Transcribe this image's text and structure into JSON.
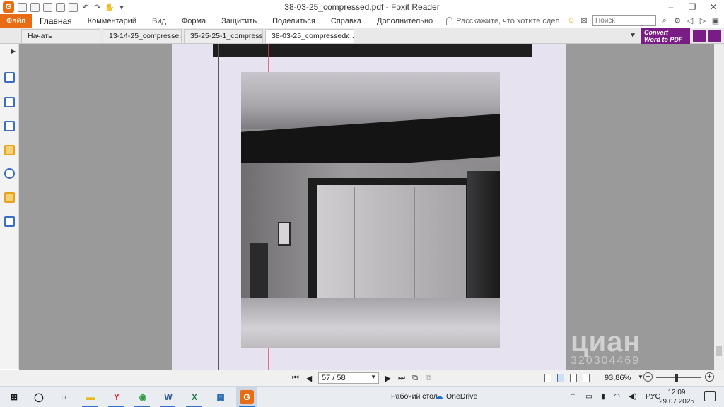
{
  "window": {
    "title": "38-03-25_compressed.pdf - Foxit Reader",
    "app_logo": "G"
  },
  "menu": {
    "file": "Файл",
    "items": [
      "Главная",
      "Комментарий",
      "Вид",
      "Форма",
      "Защитить",
      "Поделиться",
      "Справка",
      "Дополнительно"
    ],
    "tell_me": "Расскажите, что хотите сдел",
    "search_placeholder": "Поиск"
  },
  "tabs": [
    {
      "label": "Начать"
    },
    {
      "label": "13-14-25_compresse..."
    },
    {
      "label": "35-25-25-1_compress..."
    },
    {
      "label": "38-03-25_compressed...."
    }
  ],
  "convert": {
    "line1": "Convert",
    "line2": "Word to PDF",
    "color": "#7a1c86"
  },
  "sidebar_icons": [
    "bookmark-icon",
    "pages-icon",
    "layers-icon",
    "comments-icon",
    "attachments-icon",
    "security-icon",
    "signature-icon"
  ],
  "watermark": {
    "brand": "циан",
    "id": "320304469"
  },
  "status": {
    "page_display": "57 / 58",
    "zoom": "93,86%"
  },
  "taskbar": {
    "desktop_label": "Рабочий стол",
    "onedrive_label": "OneDrive",
    "language": "РУС",
    "time": "12:09",
    "date": "29.07.2025"
  },
  "colors": {
    "accent": "#e86c13",
    "page_bg": "#e6e2ef",
    "viewer_bg": "#9a9a9a"
  }
}
